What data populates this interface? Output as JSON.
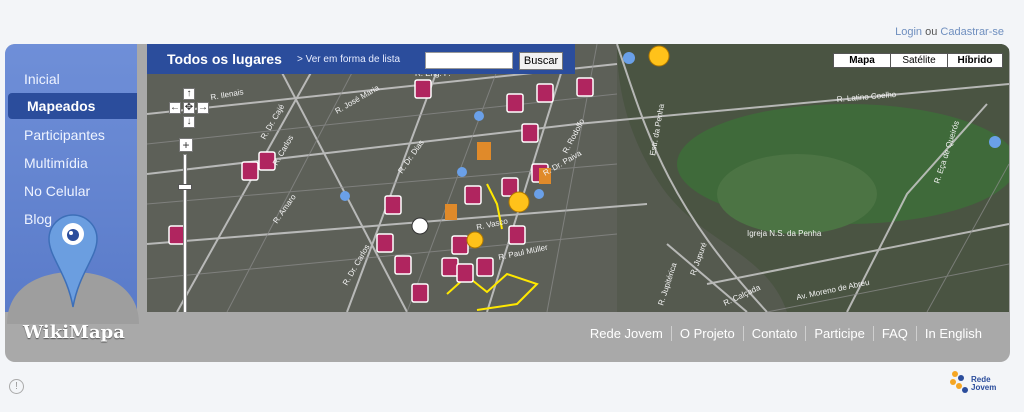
{
  "auth": {
    "login": "Login",
    "or": "ou",
    "signup": "Cadastrar-se"
  },
  "sidebar": {
    "items": [
      {
        "label": "Inicial"
      },
      {
        "label": "Mapeados"
      },
      {
        "label": "Participantes"
      },
      {
        "label": "Multimídia"
      },
      {
        "label": "No Celular"
      },
      {
        "label": "Blog"
      }
    ]
  },
  "logo": "WikiMapa",
  "map": {
    "title": "Todos os lugares",
    "list_link": "> Ver em forma de lista",
    "search_placeholder": "",
    "search_button": "Buscar",
    "types": [
      "Mapa",
      "Satélite",
      "Híbrido"
    ],
    "street_labels": [
      "R. Eng. P.",
      "R. José Maria",
      "R. Dr. Cajé",
      "R. Carlos",
      "R. Dr. Dias",
      "R. Rodolfo",
      "R. Dr. Paiva",
      "R. Paul Müller",
      "R. Vasco",
      "R. Dr. Carlos",
      "R. Amaro",
      "R. Ilenais",
      "Estr. da Penha",
      "R. Latino Coelho",
      "R. Eça de Queirós",
      "Igreja N.S. da Penha",
      "R. Jupuré",
      "R. Calçada",
      "R. Jupitérica",
      "Av. Moreno de Abreu"
    ]
  },
  "footer": {
    "links": [
      "Rede Jovem",
      "O Projeto",
      "Contato",
      "Participe",
      "FAQ",
      "In English"
    ]
  },
  "partner": {
    "line1": "Rede",
    "line2": "Jovem"
  },
  "colors": {
    "nav_blue": "#2b4d9c",
    "sidebar_blue": "#6f8fd8",
    "marker": "#b0255f",
    "frame_gray": "#a9a9a9"
  }
}
